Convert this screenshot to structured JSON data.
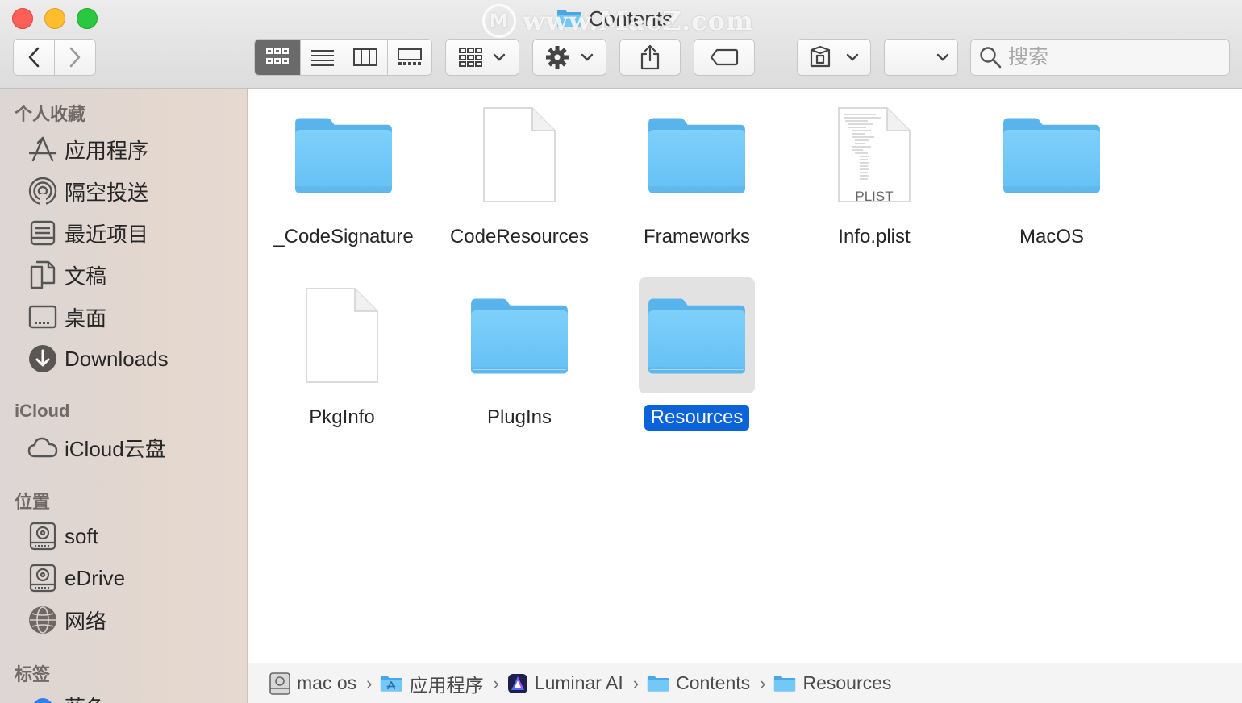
{
  "window": {
    "title": "Contents",
    "watermark": "www.MacZ.com",
    "watermark_logo": "M"
  },
  "toolbar": {
    "back_icon": "chevron-left-icon",
    "forward_icon": "chevron-right-icon",
    "view_modes": [
      "icon-view",
      "list-view",
      "column-view",
      "gallery-view"
    ],
    "active_view": "icon-view",
    "search_placeholder": "搜索"
  },
  "sidebar": {
    "favorites_header": "个人收藏",
    "favorites": [
      {
        "label": "应用程序",
        "icon": "applications-icon"
      },
      {
        "label": "隔空投送",
        "icon": "airdrop-icon"
      },
      {
        "label": "最近项目",
        "icon": "recents-icon"
      },
      {
        "label": "文稿",
        "icon": "documents-icon"
      },
      {
        "label": "桌面",
        "icon": "desktop-icon"
      },
      {
        "label": "Downloads",
        "icon": "downloads-icon"
      }
    ],
    "icloud_header": "iCloud",
    "icloud": [
      {
        "label": "iCloud云盘",
        "icon": "cloud-icon"
      }
    ],
    "locations_header": "位置",
    "locations": [
      {
        "label": "soft",
        "icon": "disk-icon"
      },
      {
        "label": "eDrive",
        "icon": "disk-icon"
      },
      {
        "label": "网络",
        "icon": "network-icon"
      }
    ],
    "tags_header": "标签",
    "tags": [
      {
        "label": "蓝色",
        "color": "#2f80ed"
      }
    ]
  },
  "files": [
    {
      "name": "_CodeSignature",
      "kind": "folder",
      "selected": false
    },
    {
      "name": "CodeResources",
      "kind": "document",
      "selected": false
    },
    {
      "name": "Frameworks",
      "kind": "folder",
      "selected": false
    },
    {
      "name": "Info.plist",
      "kind": "plist",
      "badge": "PLIST",
      "selected": false
    },
    {
      "name": "MacOS",
      "kind": "folder",
      "selected": false
    },
    {
      "name": "PkgInfo",
      "kind": "document",
      "selected": false
    },
    {
      "name": "PlugIns",
      "kind": "folder",
      "selected": false
    },
    {
      "name": "Resources",
      "kind": "folder",
      "selected": true
    }
  ],
  "pathbar": [
    {
      "label": "mac os",
      "icon": "disk-icon"
    },
    {
      "label": "应用程序",
      "icon": "applications-folder-icon"
    },
    {
      "label": "Luminar AI",
      "icon": "luminar-app-icon"
    },
    {
      "label": "Contents",
      "icon": "folder-icon"
    },
    {
      "label": "Resources",
      "icon": "folder-icon"
    }
  ],
  "colors": {
    "folder": "#6cc4f5",
    "selection": "#0a63d8",
    "sidebar_tint": "#e3d7cf"
  }
}
